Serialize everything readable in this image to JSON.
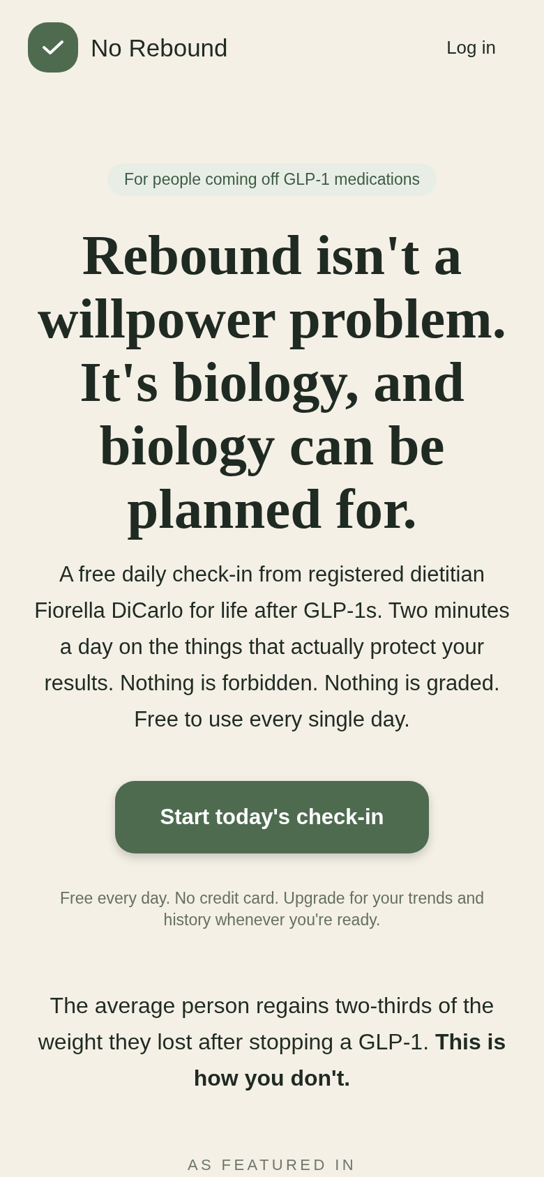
{
  "header": {
    "brand": "No Rebound",
    "login": "Log in"
  },
  "hero": {
    "badge": "For people coming off GLP-1 medications",
    "headline": "Rebound isn't a willpower problem. It's biology, and biology can be planned for.",
    "intro": "A free daily check-in from registered dietitian Fiorella DiCarlo for life after GLP-1s. Two minutes a day on the things that actually protect your results. Nothing is forbidden. Nothing is graded. Free to use every single day.",
    "cta": "Start today's check-in",
    "fine_print": "Free every day. No credit card. Upgrade for your trends and history whenever you're ready."
  },
  "stat": {
    "text": "The average person regains two-thirds of the weight they lost after stopping a GLP-1. **This is how you don't.**"
  },
  "featured": {
    "label": "AS FEATURED IN"
  }
}
